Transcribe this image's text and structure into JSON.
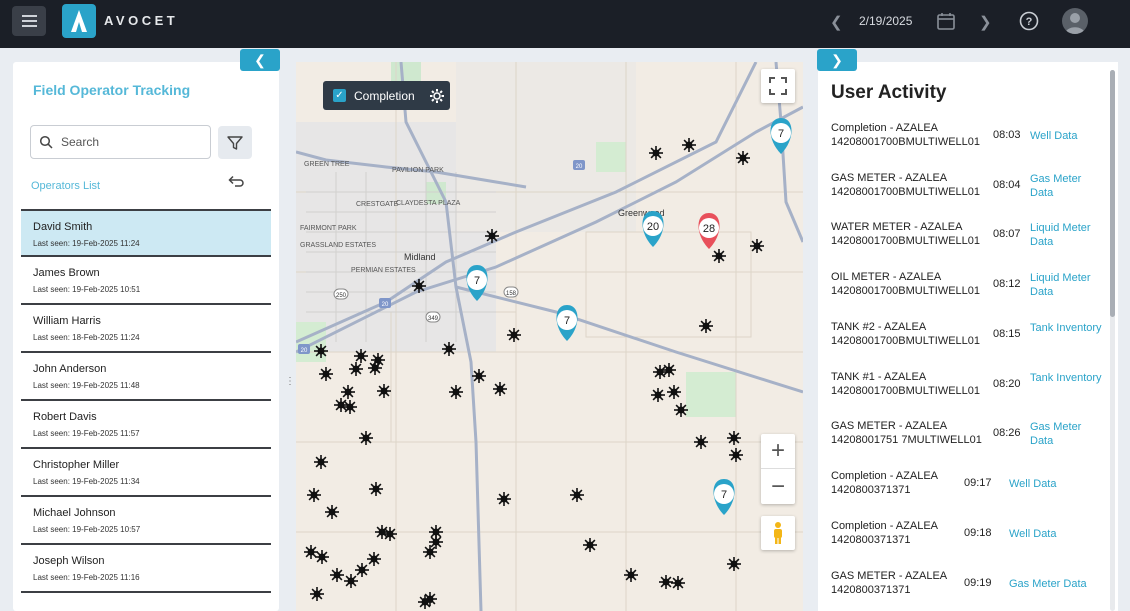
{
  "header": {
    "logo_text": "AVOCET",
    "date": "2/19/2025"
  },
  "left": {
    "title": "Field Operator Tracking",
    "search_placeholder": "Search",
    "operators_list_label": "Operators List",
    "operators": [
      {
        "name": "David Smith",
        "last_seen": "Last seen: 19-Feb-2025 11:24"
      },
      {
        "name": "James Brown",
        "last_seen": "Last seen: 19-Feb-2025 10:51"
      },
      {
        "name": "William Harris",
        "last_seen": "Last seen: 18-Feb-2025 11:24"
      },
      {
        "name": "John Anderson",
        "last_seen": "Last seen: 19-Feb-2025 11:48"
      },
      {
        "name": "Robert Davis",
        "last_seen": "Last seen: 19-Feb-2025 11:57"
      },
      {
        "name": "Christopher Miller",
        "last_seen": "Last seen: 19-Feb-2025 11:34"
      },
      {
        "name": "Michael Johnson",
        "last_seen": "Last seen: 19-Feb-2025 10:57"
      },
      {
        "name": "Joseph Wilson",
        "last_seen": "Last seen: 19-Feb-2025 11:16"
      }
    ]
  },
  "map": {
    "completion_label": "Completion",
    "place_labels": [
      "GREEN TREE",
      "PAVILION PARK",
      "CRESTGATE",
      "CLAYDESTA PLAZA",
      "FAIRMONT PARK",
      "GRASSLAND ESTATES",
      "PERMIAN ESTATES",
      "Midland",
      "Greenwood"
    ],
    "road_labels": [
      "20",
      "20",
      "158",
      "349",
      "250",
      "20"
    ],
    "cluster_counts": [
      "7",
      "20",
      "28",
      "7",
      "7",
      "7"
    ]
  },
  "right": {
    "title": "User Activity",
    "activities": [
      {
        "title": "Completion - AZALEA",
        "id": "14208001700BMULTIWELL01",
        "time": "08:03",
        "link": "Well Data"
      },
      {
        "title": "GAS METER - AZALEA",
        "id": "14208001700BMULTIWELL01",
        "time": "08:04",
        "link": "Gas Meter Data"
      },
      {
        "title": "WATER METER - AZALEA",
        "id": "14208001700BMULTIWELL01",
        "time": "08:07",
        "link": "Liquid Meter Data"
      },
      {
        "title": "OIL METER - AZALEA",
        "id": "14208001700BMULTIWELL01",
        "time": "08:12",
        "link": "Liquid Meter Data"
      },
      {
        "title": "TANK #2 - AZALEA",
        "id": "14208001700BMULTIWELL01",
        "time": "08:15",
        "link": "Tank Inventory"
      },
      {
        "title": "TANK #1 - AZALEA",
        "id": "14208001700BMULTIWELL01",
        "time": "08:20",
        "link": "Tank Inventory"
      },
      {
        "title": "GAS METER - AZALEA",
        "id": "14208001751 7MULTIWELL01",
        "time": "08:26",
        "link": "Gas Meter Data"
      },
      {
        "title": "Completion - AZALEA",
        "id": "1420800371371",
        "time": "09:17",
        "link": "Well Data"
      },
      {
        "title": "Completion - AZALEA",
        "id": "1420800371371",
        "time": "09:18",
        "link": "Well Data"
      },
      {
        "title": "GAS METER - AZALEA",
        "id": "1420800371371",
        "time": "09:19",
        "link": "Gas Meter Data"
      }
    ]
  },
  "colors": {
    "accent": "#2aa3c9",
    "topbar": "#1b1f27",
    "cluster_red": "#e8505b",
    "selected_row": "#cde9f3"
  }
}
